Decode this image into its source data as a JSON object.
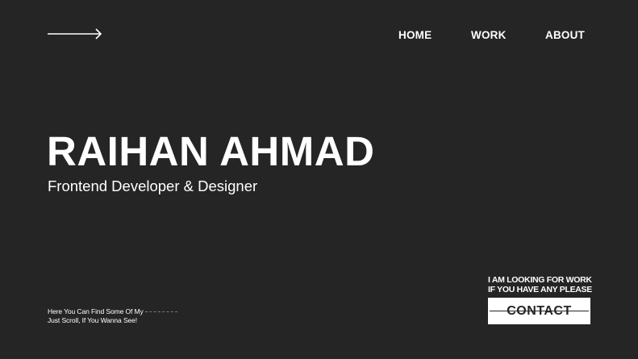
{
  "header": {
    "nav": {
      "home": "HOME",
      "work": "WORK",
      "about": "ABOUT"
    }
  },
  "hero": {
    "name": "RAIHAN AHMAD",
    "role": "Frontend Developer & Designer"
  },
  "scroll_hint": {
    "line1": "Here You Can Find Some Of My",
    "line2": "Just Scroll, If You Wanna See!"
  },
  "cta": {
    "line1": "I AM LOOKING FOR WORK",
    "line2": "IF YOU HAVE ANY PLEASE",
    "button_label": "CONTACT"
  },
  "colors": {
    "background": "#252525",
    "foreground": "#ffffff"
  },
  "icons": {
    "top_left": "arrow-right-icon"
  }
}
